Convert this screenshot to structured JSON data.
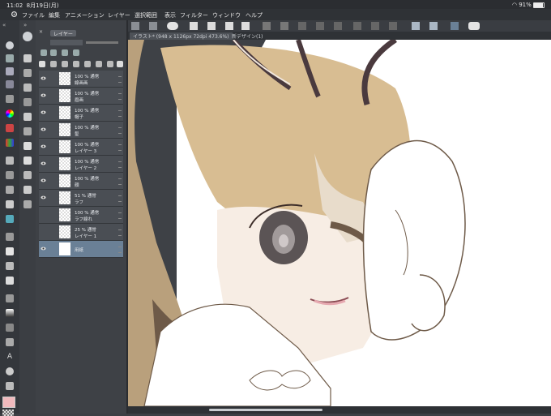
{
  "status_bar": {
    "time": "11:02",
    "date": "8月19日(月)",
    "battery": "91%"
  },
  "menu": [
    "ファイル",
    "編集",
    "アニメーション",
    "レイヤー",
    "選択範囲",
    "表示",
    "フィルター",
    "ウィンドウ",
    "ヘルプ"
  ],
  "layer_panel": {
    "tab_label": "レイヤー",
    "layers": [
      {
        "line1": "100 % 通常",
        "line2": "線画画"
      },
      {
        "line1": "100 % 通常",
        "line2": "眉画"
      },
      {
        "line1": "100 % 通常",
        "line2": "帽子"
      },
      {
        "line1": "100 % 通常",
        "line2": "髪"
      },
      {
        "line1": "100 % 通常",
        "line2": "レイヤー 3"
      },
      {
        "line1": "100 % 通常",
        "line2": "レイヤー 2"
      },
      {
        "line1": "100 % 通常",
        "line2": "顔"
      },
      {
        "line1": "51 % 通常",
        "line2": "ラフ"
      },
      {
        "line1": "100 % 通常",
        "line2": "ラフ線れ"
      },
      {
        "line1": "25 % 通常",
        "line2": "レイヤー 1"
      },
      {
        "line1": "",
        "line2": "用紙"
      }
    ]
  },
  "document_tabs": {
    "active": "イラスト* (948 x 1126px 72dpi 473.6%)",
    "inactive": "新デザイン(1)"
  },
  "colors": {
    "main_color": "#f0b9bd",
    "accent": "#6a8096"
  }
}
